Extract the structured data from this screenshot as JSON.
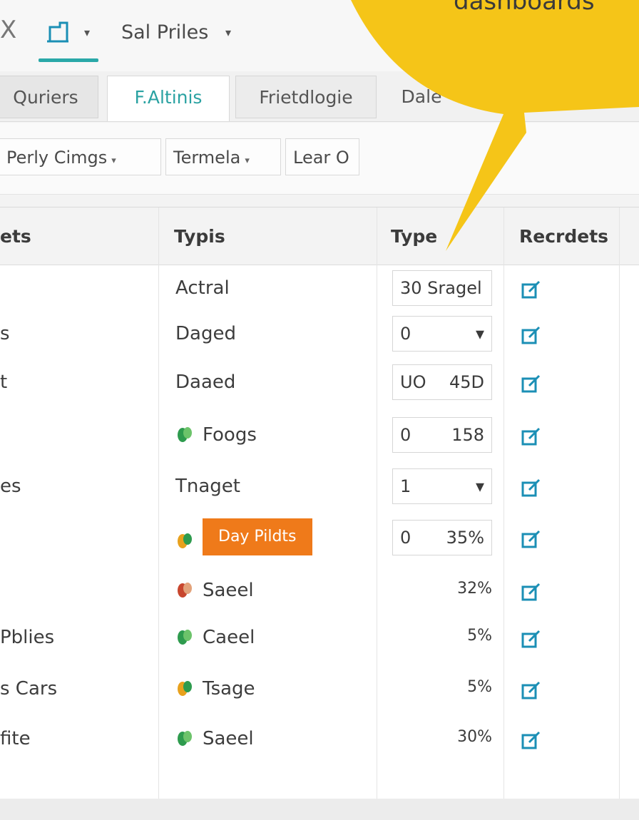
{
  "toolbar": {
    "back_glyph": "X",
    "app_menu_icon": "document-edit-icon",
    "file_menu_label": "Sal Priles"
  },
  "tabs": [
    {
      "label": "Quriers"
    },
    {
      "label": "F.Altinis"
    },
    {
      "label": "Frietdlogie"
    },
    {
      "label": "Dale"
    }
  ],
  "active_tab_index": 1,
  "filters": [
    {
      "label": "Perly Cimgs"
    },
    {
      "label": "Termela"
    },
    {
      "label": "Lear O"
    }
  ],
  "table": {
    "columns": [
      "ets",
      "Typis",
      "Type",
      "Recrdets"
    ],
    "rows": [
      {
        "name": "",
        "type": "Actral",
        "icon": "",
        "value_left": "30 Sragel",
        "value_right": "",
        "boxed": true,
        "badge": false
      },
      {
        "name": "s",
        "type": "Daged",
        "icon": "",
        "value_left": "0",
        "value_right": "▾",
        "boxed": true,
        "badge": false
      },
      {
        "name": "t",
        "type": "Daaed",
        "icon": "",
        "value_left": "UO",
        "value_right": "45D",
        "boxed": true,
        "badge": false
      },
      {
        "name": "",
        "type": "Foogs",
        "icon": "green-leaf-icon",
        "value_left": "0",
        "value_right": "158",
        "boxed": true,
        "badge": false
      },
      {
        "name": "es",
        "type": "Tnaget",
        "icon": "",
        "value_left": "1",
        "value_right": "▾",
        "boxed": true,
        "badge": false
      },
      {
        "name": "",
        "type": "Day Pildts",
        "icon": "multicolor-leaf-icon",
        "value_left": "0",
        "value_right": "35%",
        "boxed": true,
        "badge": true
      },
      {
        "name": "",
        "type": "Saeel",
        "icon": "red-leaf-icon",
        "value_left": "",
        "value_right": "32%",
        "boxed": false,
        "badge": false
      },
      {
        "name": "Pblies",
        "type": "Caeel",
        "icon": "green-leaf-icon",
        "value_left": "",
        "value_right": "5%",
        "boxed": false,
        "badge": false
      },
      {
        "name": "s Cars",
        "type": "Tsage",
        "icon": "multicolor-leaf-icon",
        "value_left": "",
        "value_right": "5%",
        "boxed": false,
        "badge": false
      },
      {
        "name": "fite",
        "type": "Saeel",
        "icon": "green-leaf-icon",
        "value_left": "",
        "value_right": "30%",
        "boxed": false,
        "badge": false
      }
    ]
  },
  "callout": {
    "text": "dashboards",
    "color": "#f5c518"
  },
  "colors": {
    "accent": "#2aa8a8",
    "badge": "#ef7a1a",
    "record_icon": "#1b8fb5"
  }
}
